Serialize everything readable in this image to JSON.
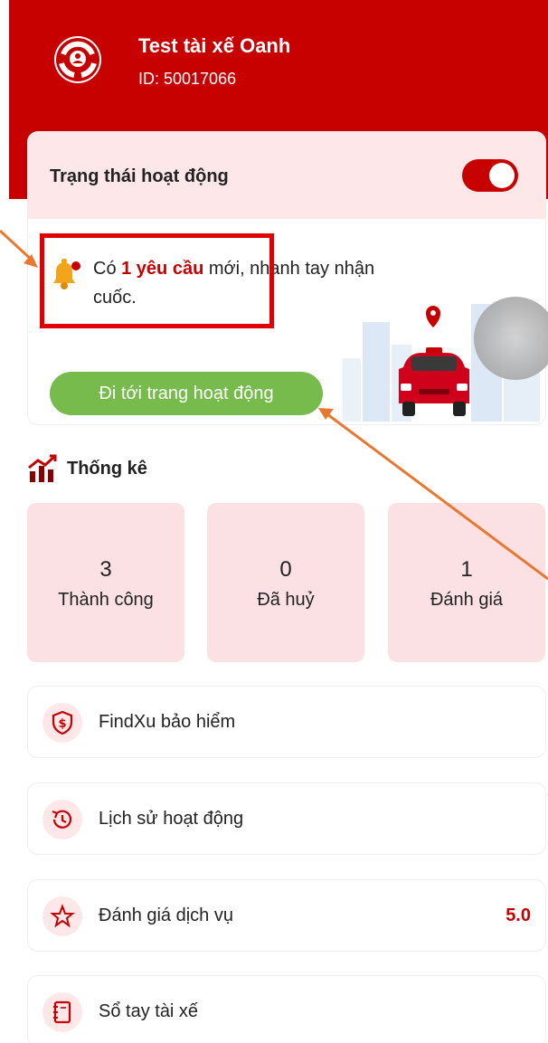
{
  "header": {
    "driver_name": "Test tài xế Oanh",
    "driver_id": "ID: 50017066",
    "logo_icon": "shield-driver-logo-icon"
  },
  "status": {
    "label": "Trạng thái hoạt động",
    "toggle_on": true,
    "notification_prefix": "Có ",
    "notification_highlight": "1 yêu cầu",
    "notification_suffix": " mới, nhanh tay nhận cuốc.",
    "go_button": "Đi tới trang hoạt động"
  },
  "stats": {
    "title": "Thống kê",
    "items": [
      {
        "value": "3",
        "label": "Thành công"
      },
      {
        "value": "0",
        "label": "Đã huỷ"
      },
      {
        "value": "1",
        "label": "Đánh giá"
      }
    ]
  },
  "menu": {
    "items": [
      {
        "label": "FindXu bảo hiểm",
        "icon": "shield-dollar-icon"
      },
      {
        "label": "Lịch sử hoạt động",
        "icon": "history-icon"
      },
      {
        "label": "Đánh giá dịch vụ",
        "icon": "star-icon",
        "value": "5.0"
      },
      {
        "label": "Sổ tay tài xế",
        "icon": "notebook-icon"
      }
    ]
  },
  "colors": {
    "brand_red": "#c70000",
    "button_green": "#76bb4c",
    "card_pink": "#fbe1e4",
    "annotation_orange": "#e8782f"
  }
}
